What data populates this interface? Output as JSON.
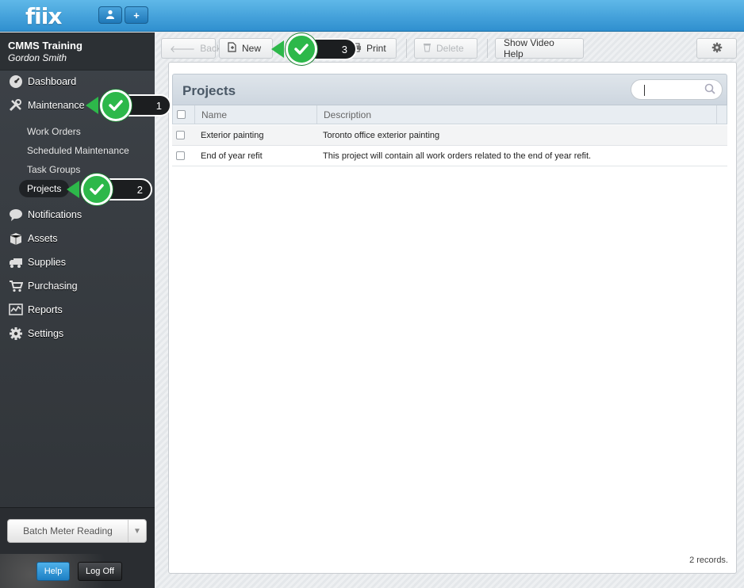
{
  "app": {
    "logo": "fiix"
  },
  "topbar": {
    "user_icon": "user-icon",
    "add_icon": "plus-icon",
    "add_label": "+"
  },
  "user": {
    "org": "CMMS Training",
    "name": "Gordon Smith"
  },
  "sidebar": {
    "items": [
      {
        "label": "Dashboard",
        "icon": "dashboard-icon"
      },
      {
        "label": "Maintenance",
        "icon": "tools-icon"
      },
      {
        "label": "Notifications",
        "icon": "speech-bubble-icon"
      },
      {
        "label": "Assets",
        "icon": "box-icon"
      },
      {
        "label": "Supplies",
        "icon": "truck-icon"
      },
      {
        "label": "Purchasing",
        "icon": "cart-icon"
      },
      {
        "label": "Reports",
        "icon": "chart-icon"
      },
      {
        "label": "Settings",
        "icon": "gear-icon"
      }
    ],
    "sub_items": [
      {
        "label": "Work Orders"
      },
      {
        "label": "Scheduled Maintenance"
      },
      {
        "label": "Task Groups"
      },
      {
        "label": "Projects",
        "active": true
      }
    ],
    "batch_label": "Batch Meter Reading",
    "help_label": "Help",
    "logoff_label": "Log Off"
  },
  "toolbar": {
    "back_label": "Back",
    "new_label": "New",
    "print_label": "Print",
    "delete_label": "Delete",
    "video_label": "Show Video Help"
  },
  "grid": {
    "title": "Projects",
    "search_placeholder": "",
    "columns": [
      "Name",
      "Description"
    ],
    "rows": [
      {
        "name": "Exterior painting",
        "description": "Toronto office exterior painting"
      },
      {
        "name": "End of year refit",
        "description": "This project will contain all work orders related to the end of year refit."
      }
    ],
    "records_text": "2 records."
  },
  "callouts": [
    {
      "number": "1"
    },
    {
      "number": "2"
    },
    {
      "number": "3"
    }
  ],
  "colors": {
    "accent": "#2f8fcf",
    "callout_green": "#2db84a",
    "sidebar_bg": "#3a3f44"
  }
}
